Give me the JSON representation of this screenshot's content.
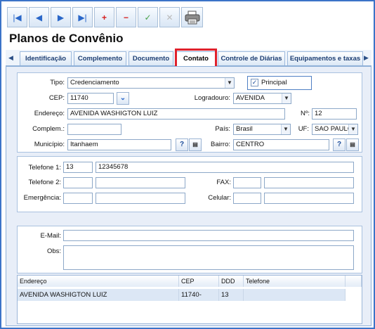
{
  "toolbar": {
    "first_icon": "first-record-icon",
    "prev_icon": "previous-record-icon",
    "next_icon": "next-record-icon",
    "last_icon": "last-record-icon",
    "add_icon": "add-icon",
    "remove_icon": "remove-icon",
    "confirm_icon": "confirm-icon",
    "cancel_icon": "cancel-icon",
    "print_icon": "printer-icon"
  },
  "page": {
    "title": "Planos de Convênio"
  },
  "tabs": [
    {
      "label": "Identificação"
    },
    {
      "label": "Complemento"
    },
    {
      "label": "Documento"
    },
    {
      "label": "Contato"
    },
    {
      "label": "Controle de Diárias"
    },
    {
      "label": "Equipamentos e taxas"
    }
  ],
  "address": {
    "tipo_label": "Tipo:",
    "tipo_value": "Credenciamento",
    "principal_label": "Principal",
    "principal_checked": true,
    "cep_label": "CEP:",
    "cep_value": "11740",
    "logradouro_label": "Logradouro:",
    "logradouro_value": "AVENIDA",
    "endereco_label": "Endereço:",
    "endereco_value": "AVENIDA WASHIGTON LUIZ",
    "numero_label": "Nº:",
    "numero_value": "12",
    "complemento_label": "Complem.:",
    "complemento_value": "",
    "pais_label": "País:",
    "pais_value": "Brasil",
    "uf_label": "UF:",
    "uf_value": "SAO PAULO",
    "municipio_label": "Município:",
    "municipio_value": "Itanhaem",
    "bairro_label": "Bairro:",
    "bairro_value": "CENTRO",
    "help_glyph": "?"
  },
  "phones": {
    "telefone1_label": "Telefone 1:",
    "telefone1_ddd": "13",
    "telefone1_number": "12345678",
    "telefone2_label": "Telefone 2:",
    "fax_label": "FAX:",
    "emergencia_label": "Emergência:",
    "celular_label": "Celular:"
  },
  "contact": {
    "email_label": "E-Mail:",
    "obs_label": "Obs:"
  },
  "grid": {
    "columns": [
      "Endereço",
      "CEP",
      "DDD",
      "Telefone"
    ],
    "rows": [
      {
        "endereco": "AVENIDA WASHIGTON LUIZ",
        "cep": "11740-",
        "ddd": "13",
        "telefone": ""
      }
    ]
  }
}
